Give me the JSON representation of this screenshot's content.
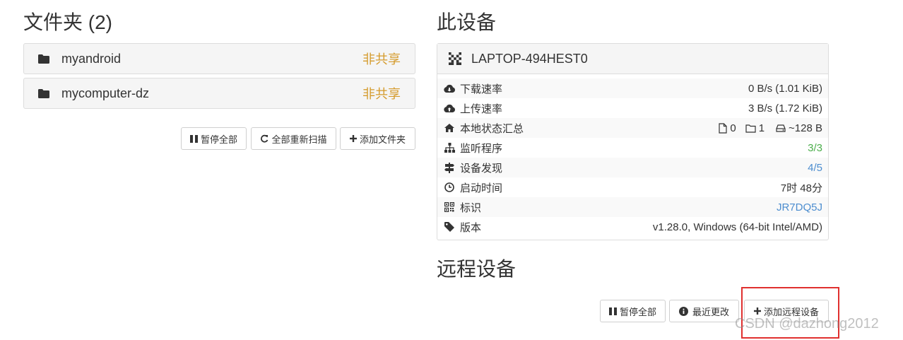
{
  "folders_section": {
    "title": "文件夹 (2)",
    "items": [
      {
        "name": "myandroid",
        "status": "非共享"
      },
      {
        "name": "mycomputer-dz",
        "status": "非共享"
      }
    ],
    "buttons": {
      "pause_all": "暂停全部",
      "rescan_all": "全部重新扫描",
      "add_folder": "添加文件夹"
    }
  },
  "this_device": {
    "title": "此设备",
    "name": "LAPTOP-494HEST0",
    "rows": {
      "download": {
        "label": "下载速率",
        "value": "0 B/s (1.01 KiB)"
      },
      "upload": {
        "label": "上传速率",
        "value": "3 B/s (1.72 KiB)"
      },
      "local_state": {
        "label": "本地状态汇总",
        "files": "0",
        "dirs": "1",
        "size": "~128 B"
      },
      "listeners": {
        "label": "监听程序",
        "value": "3/3"
      },
      "discovery": {
        "label": "设备发现",
        "value": "4/5"
      },
      "uptime": {
        "label": "启动时间",
        "value": "7时 48分"
      },
      "identity": {
        "label": "标识",
        "value": "JR7DQ5J"
      },
      "version": {
        "label": "版本",
        "value": "v1.28.0, Windows (64-bit Intel/AMD)"
      }
    }
  },
  "remote_devices": {
    "title": "远程设备",
    "buttons": {
      "pause_all": "暂停全部",
      "recent_changes": "最近更改",
      "add_remote": "添加远程设备"
    }
  },
  "watermark": "CSDN @dazhong2012",
  "colors": {
    "unshared": "#d59b2c",
    "ok_green": "#4cae4c",
    "link_blue": "#4c8dcf",
    "highlight_red": "#e0302f"
  }
}
